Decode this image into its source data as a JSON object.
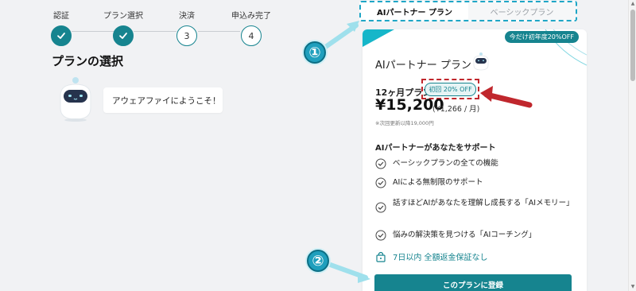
{
  "stepper": {
    "steps": [
      {
        "label": "認証",
        "state": "done"
      },
      {
        "label": "プラン選択",
        "state": "done"
      },
      {
        "label": "決済",
        "number": "3"
      },
      {
        "label": "申込み完了",
        "number": "4"
      }
    ]
  },
  "page_title": "プランの選択",
  "greeting": "アウェアファイにようこそ！",
  "tabs": [
    {
      "label": "AIパートナー プラン",
      "active": true
    },
    {
      "label": "ベーシックプラン",
      "active": false
    }
  ],
  "card": {
    "promo_badge": "今だけ初年度20%OFF",
    "plan_name": "AIパートナー プラン",
    "term": "12ヶ月プラン",
    "discount_badge": "初回 20% OFF",
    "price": "¥15,200",
    "monthly": "(¥1,266 / 月)",
    "renewal_note": "※次回更新以降19,000円",
    "support_title": "AIパートナーがあなたをサポート",
    "features": [
      "ベーシックプランの全ての機能",
      "AIによる無制限のサポート",
      "話すほどAIがあなたを理解し成長する「AIメモリー」",
      "悩みの解決策を見つける「AIコーチング」"
    ],
    "guarantee": "7日以内 全額返金保証なし",
    "cta_label": "このプランに登録"
  },
  "annotations": {
    "badge1": "①",
    "badge2": "②"
  },
  "colors": {
    "accent": "#16848f",
    "annotation_blue": "#1fa6c6",
    "annotation_red": "#c0272d",
    "background": "#f1f2f4"
  }
}
